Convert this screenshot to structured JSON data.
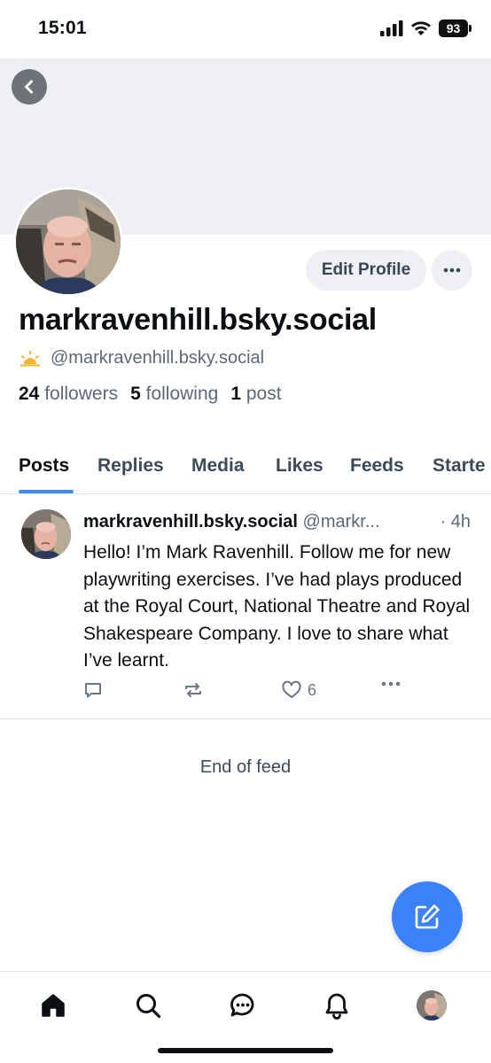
{
  "status_bar": {
    "time": "15:01",
    "battery": "93"
  },
  "profile": {
    "display_name": "markravenhill.bsky.social",
    "handle": "@markravenhill.bsky.social",
    "followers_count": "24",
    "followers_label": "followers",
    "following_count": "5",
    "following_label": "following",
    "posts_count": "1",
    "posts_label": "post",
    "edit_profile_label": "Edit Profile"
  },
  "tabs": [
    {
      "label": "Posts",
      "active": true
    },
    {
      "label": "Replies",
      "active": false
    },
    {
      "label": "Media",
      "active": false
    },
    {
      "label": "Likes",
      "active": false
    },
    {
      "label": "Feeds",
      "active": false
    },
    {
      "label": "Starte",
      "active": false
    }
  ],
  "post": {
    "author": "markravenhill.bsky.social",
    "handle": "@markr...",
    "time": "· 4h",
    "text": "Hello! I’m Mark Ravenhill. Follow me for new playwriting exercises. I’ve had plays produced at the Royal Court, National Theatre and Royal Shakespeare Company. I love to share what I’ve learnt.",
    "likes": "6"
  },
  "feed": {
    "end_label": "End of feed"
  },
  "icons": {
    "back": "chevron-left-icon",
    "more": "ellipsis-icon",
    "compose": "compose-icon",
    "nav": [
      "home-icon",
      "search-icon",
      "chat-icon",
      "bell-icon",
      "profile-avatar"
    ]
  },
  "colors": {
    "accent": "#3b82f6",
    "tab_underline": "#3b8bf2",
    "banner": "#eef0f3"
  }
}
